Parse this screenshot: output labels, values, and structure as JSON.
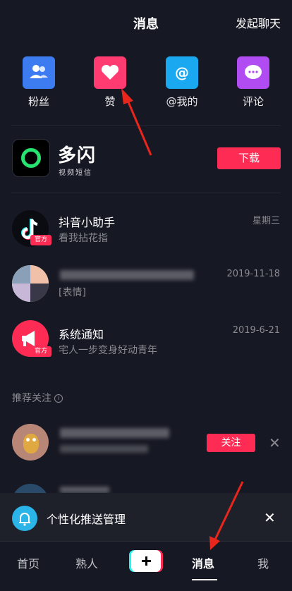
{
  "header": {
    "title": "消息",
    "right_action": "发起聊天"
  },
  "quick_actions": [
    {
      "label": "粉丝",
      "icon": "fans-icon",
      "color": "#3d7cf0"
    },
    {
      "label": "赞",
      "icon": "heart-icon",
      "color": "#ff3b72"
    },
    {
      "label": "@我的",
      "icon": "at-icon",
      "color": "#1aa9f0"
    },
    {
      "label": "评论",
      "icon": "comment-icon",
      "color": "#b14cf2"
    }
  ],
  "promo": {
    "name": "多闪",
    "subtitle": "视频短信",
    "button": "下载"
  },
  "messages": [
    {
      "title": "抖音小助手",
      "subtitle": "看我拈花指",
      "time": "星期三",
      "badge": "官方"
    },
    {
      "title": "",
      "subtitle": "[表情]",
      "time": "2019-11-18",
      "badge": ""
    },
    {
      "title": "系统通知",
      "subtitle": "宅人一步变身好动青年",
      "time": "2019-6-21",
      "badge": "官方"
    }
  ],
  "recommend": {
    "section_title": "推荐关注",
    "follow_button": "关注"
  },
  "push": {
    "text": "个性化推送管理"
  },
  "nav": {
    "items": [
      "首页",
      "熟人",
      "消息",
      "我"
    ],
    "active": "消息"
  },
  "colors": {
    "accent": "#fe2c55",
    "bg": "#161823"
  }
}
